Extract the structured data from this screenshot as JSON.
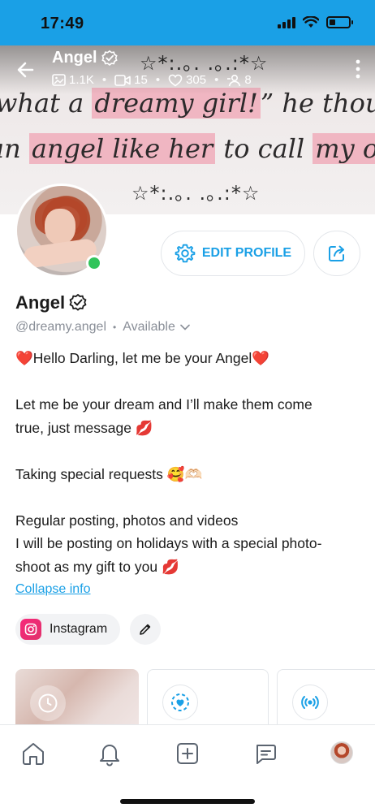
{
  "status_bar": {
    "time": "17:49",
    "battery_level": 0.3
  },
  "header": {
    "name": "Angel",
    "stats": {
      "photos": "1.1K",
      "videos": "15",
      "likes": "305",
      "subscribers": "8"
    },
    "icons": {
      "back": "back-arrow-icon",
      "verified": "verified-badge-icon",
      "photos": "image-icon",
      "videos": "video-icon",
      "likes": "heart-icon",
      "subscribers": "person-icon",
      "more": "more-vertical-icon"
    }
  },
  "banner": {
    "stars_top": "☆*:.｡. .｡.:*☆",
    "line1_pre": "what a ",
    "line1_hl": "dreamy girl!",
    "line1_post": "” he though",
    "line2_pre": "an ",
    "line2_hl": "angel like her",
    "line2_mid": " to call ",
    "line2_hl2": "my own",
    "stars_bottom": "☆*:.｡. .｡.:*☆",
    "highlight_color": "#f0b6c2"
  },
  "actions": {
    "edit_profile_label": "EDIT PROFILE"
  },
  "profile": {
    "name": "Angel",
    "handle": "@dreamy.angel",
    "availability": "Available",
    "bio": {
      "line1": "❤️Hello Darling, let me be your Angel❤️",
      "line2": "Let me be your dream and I’ll make them come",
      "line3": "true, just message 💋",
      "line4": "Taking special requests 🥰🫶🏻",
      "line5": "Regular posting, photos and videos",
      "line6": "I will be posting on holidays with a special photo-",
      "line7": "shoot as my gift to you 💋"
    },
    "collapse_label": "Collapse info",
    "social_label": "Instagram"
  },
  "bottom_nav": {
    "items": [
      "home-icon",
      "bell-icon",
      "plus-square-icon",
      "chat-icon",
      "avatar"
    ]
  },
  "colors": {
    "accent": "#1aa0e6",
    "status_bar": "#1aa0e6",
    "online": "#31c45b",
    "instagram": "#e1306c"
  }
}
